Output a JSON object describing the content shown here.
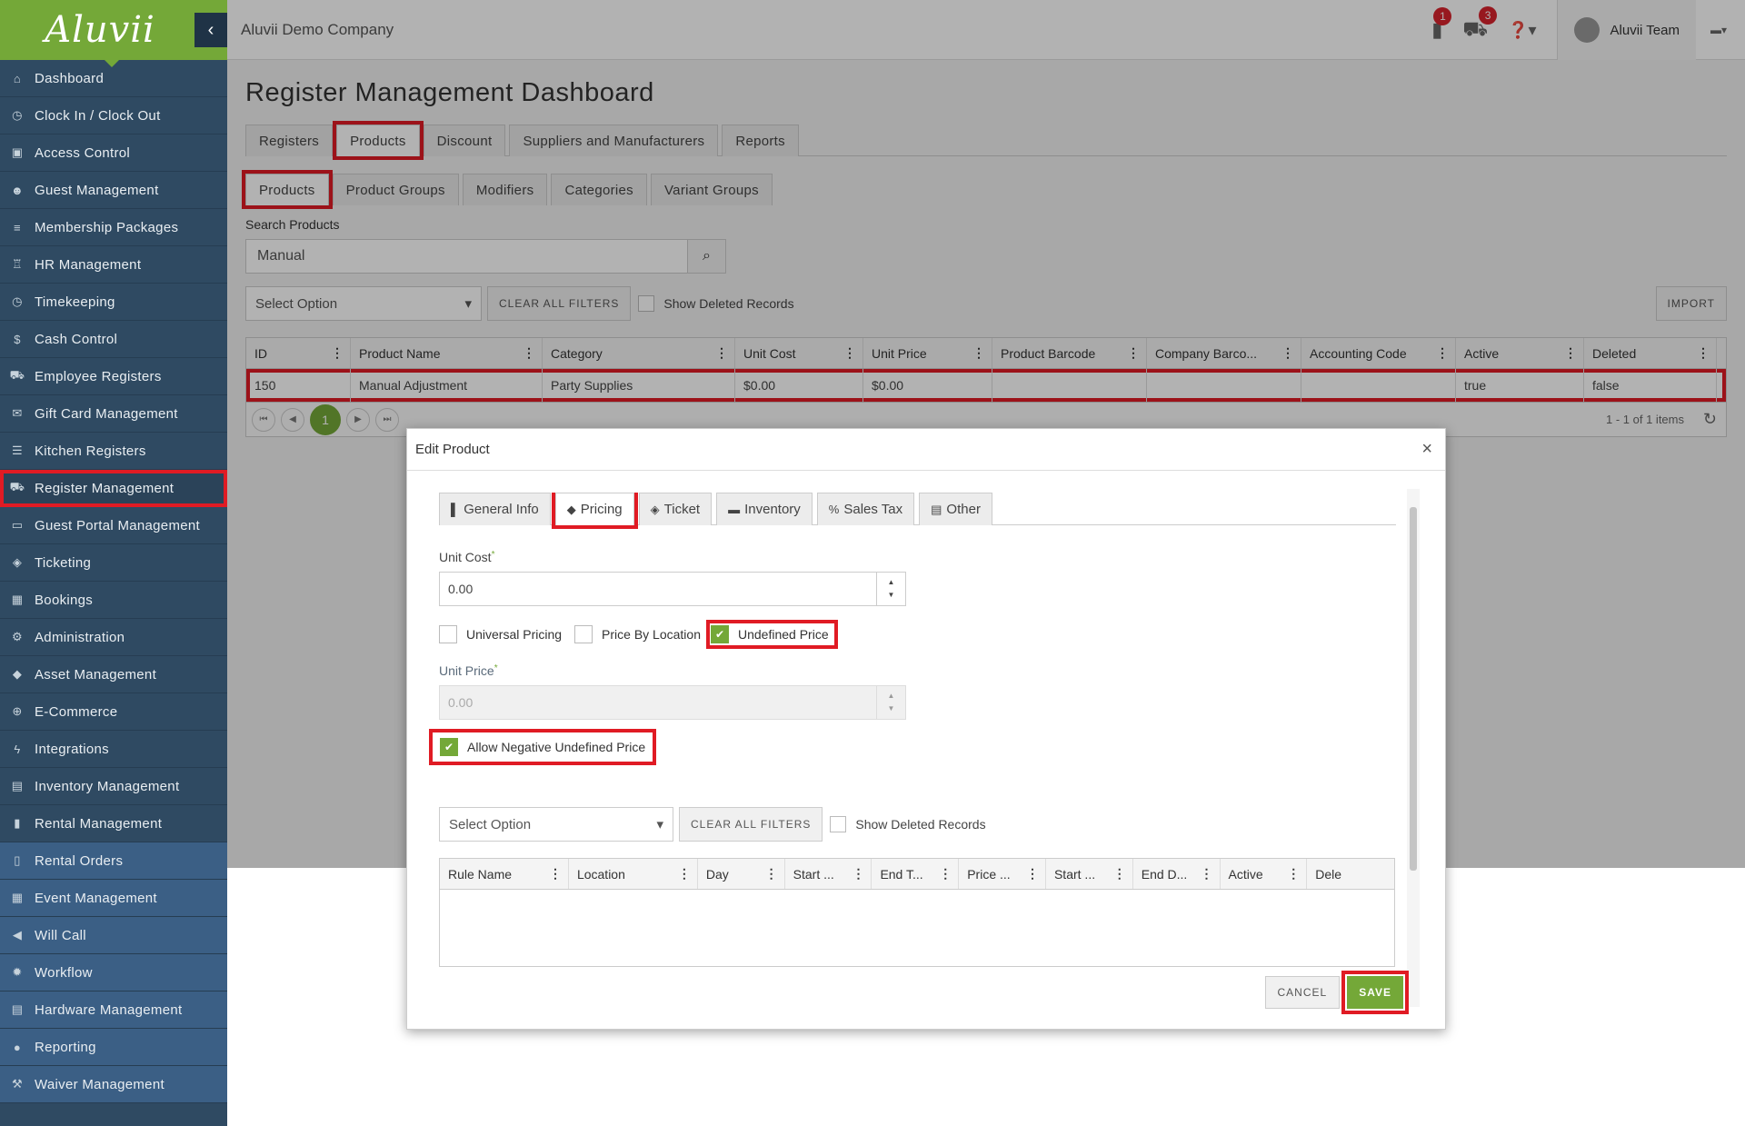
{
  "app": {
    "logo": "Aluvii",
    "company": "Aluvii Demo Company",
    "user": "Aluvii Team",
    "badge_bag": "1",
    "badge_cart": "3"
  },
  "sidebar": {
    "items": [
      {
        "label": "Dashboard",
        "icon": "home-icon",
        "glyph": "⌂"
      },
      {
        "label": "Clock In / Clock Out",
        "icon": "clock-icon",
        "glyph": "◷"
      },
      {
        "label": "Access Control",
        "icon": "lock-icon",
        "glyph": "▣"
      },
      {
        "label": "Guest Management",
        "icon": "users-icon",
        "glyph": "☻"
      },
      {
        "label": "Membership Packages",
        "icon": "list-icon",
        "glyph": "≡"
      },
      {
        "label": "HR Management",
        "icon": "trophy-icon",
        "glyph": "♖"
      },
      {
        "label": "Timekeeping",
        "icon": "clock-icon",
        "glyph": "◷"
      },
      {
        "label": "Cash Control",
        "icon": "dollar-icon",
        "glyph": "$"
      },
      {
        "label": "Employee Registers",
        "icon": "cart-icon",
        "glyph": "⛟"
      },
      {
        "label": "Gift Card Management",
        "icon": "gift-icon",
        "glyph": "✉"
      },
      {
        "label": "Kitchen Registers",
        "icon": "list-icon",
        "glyph": "☰"
      },
      {
        "label": "Register Management",
        "icon": "cart-icon",
        "glyph": "⛟"
      },
      {
        "label": "Guest Portal Management",
        "icon": "laptop-icon",
        "glyph": "▭"
      },
      {
        "label": "Ticketing",
        "icon": "ticket-icon",
        "glyph": "◈"
      },
      {
        "label": "Bookings",
        "icon": "calendar-icon",
        "glyph": "▦"
      },
      {
        "label": "Administration",
        "icon": "cogs-icon",
        "glyph": "⚙"
      },
      {
        "label": "Asset Management",
        "icon": "cubes-icon",
        "glyph": "◆"
      },
      {
        "label": "E-Commerce",
        "icon": "globe-icon",
        "glyph": "⊕"
      },
      {
        "label": "Integrations",
        "icon": "bolt-icon",
        "glyph": "ϟ"
      },
      {
        "label": "Inventory Management",
        "icon": "archive-icon",
        "glyph": "▤"
      },
      {
        "label": "Rental Management",
        "icon": "clipboard-icon",
        "glyph": "▮"
      },
      {
        "label": "Rental Orders",
        "icon": "file-icon",
        "glyph": "▯"
      },
      {
        "label": "Event Management",
        "icon": "calendar-check-icon",
        "glyph": "▦"
      },
      {
        "label": "Will Call",
        "icon": "bullhorn-icon",
        "glyph": "◀"
      },
      {
        "label": "Workflow",
        "icon": "gear-icon",
        "glyph": "✹"
      },
      {
        "label": "Hardware Management",
        "icon": "print-icon",
        "glyph": "▤"
      },
      {
        "label": "Reporting",
        "icon": "bulb-icon",
        "glyph": "●"
      },
      {
        "label": "Waiver Management",
        "icon": "gavel-icon",
        "glyph": "⚒"
      }
    ]
  },
  "page": {
    "title": "Register Management Dashboard",
    "tabs": [
      "Registers",
      "Products",
      "Discount",
      "Suppliers and Manufacturers",
      "Reports"
    ],
    "subtabs": [
      "Products",
      "Product Groups",
      "Modifiers",
      "Categories",
      "Variant Groups"
    ],
    "search_label": "Search Products",
    "search_value": "Manual",
    "select_placeholder": "Select Option",
    "clear_filters": "CLEAR ALL FILTERS",
    "show_deleted": "Show Deleted Records",
    "import": "IMPORT",
    "columns": [
      "ID",
      "Product Name",
      "Category",
      "Unit Cost",
      "Unit Price",
      "Product Barcode",
      "Company Barco...",
      "Accounting Code",
      "Active",
      "Deleted"
    ],
    "rows": [
      [
        "150",
        "Manual Adjustment",
        "Party Supplies",
        "$0.00",
        "$0.00",
        "",
        "",
        "",
        "true",
        "false"
      ]
    ],
    "current_page": "1",
    "pager_info": "1 - 1 of 1 items"
  },
  "modal": {
    "title": "Edit Product",
    "tabs": [
      {
        "label": "General Info",
        "icon": "file-icon",
        "glyph": "▌"
      },
      {
        "label": "Pricing",
        "icon": "tag-icon",
        "glyph": "◆"
      },
      {
        "label": "Ticket",
        "icon": "ticket-icon",
        "glyph": "◈"
      },
      {
        "label": "Inventory",
        "icon": "briefcase-icon",
        "glyph": "▬"
      },
      {
        "label": "Sales Tax",
        "icon": "percent-icon",
        "glyph": "%"
      },
      {
        "label": "Other",
        "icon": "archive-icon",
        "glyph": "▤"
      }
    ],
    "unit_cost_label": "Unit Cost",
    "unit_cost_value": "0.00",
    "universal_pricing": "Universal Pricing",
    "price_by_location": "Price By Location",
    "undefined_price": "Undefined Price",
    "unit_price_label": "Unit Price",
    "unit_price_value": "0.00",
    "allow_negative": "Allow Negative Undefined Price",
    "select_placeholder": "Select Option",
    "clear_filters": "CLEAR ALL FILTERS",
    "show_deleted": "Show Deleted Records",
    "columns": [
      "Rule Name",
      "Location",
      "Day",
      "Start ...",
      "End T...",
      "Price ...",
      "Start ...",
      "End D...",
      "Active",
      "Dele"
    ],
    "cancel": "CANCEL",
    "save": "SAVE"
  }
}
